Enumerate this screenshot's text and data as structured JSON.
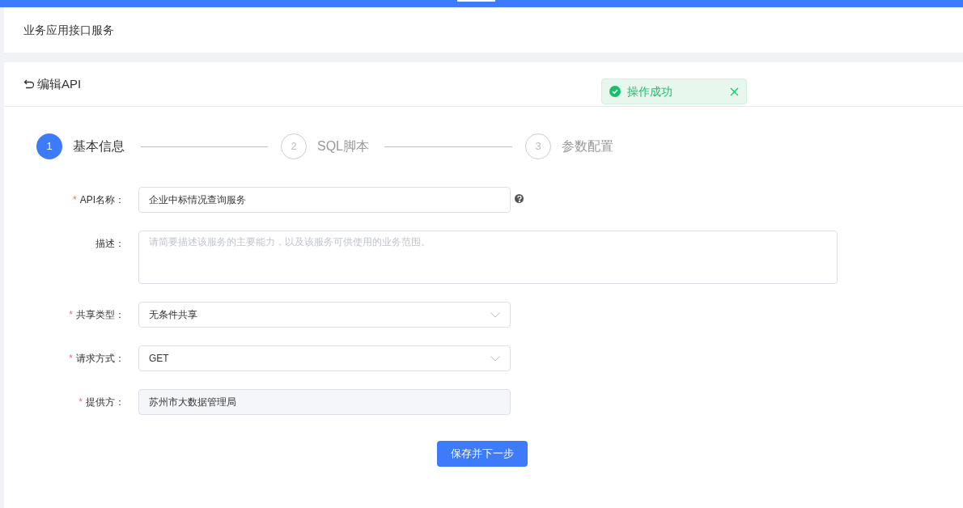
{
  "header": {
    "title": "业务应用接口服务"
  },
  "page": {
    "back_label": "编辑API"
  },
  "toast": {
    "message": "操作成功"
  },
  "steps": [
    {
      "number": "1",
      "label": "基本信息",
      "active": true
    },
    {
      "number": "2",
      "label": "SQL脚本",
      "active": false
    },
    {
      "number": "3",
      "label": "参数配置",
      "active": false
    }
  ],
  "fields": [
    {
      "kind": "input",
      "required_mark": "*",
      "label": "API名称：",
      "value": "企业中标情况查询服务",
      "help": true
    },
    {
      "kind": "textarea",
      "label": "描述：",
      "placeholder": "请简要描述该服务的主要能力，以及该服务可供使用的业务范围。"
    },
    {
      "kind": "select",
      "required_mark": "*",
      "label": "共享类型：",
      "value": "无条件共享"
    },
    {
      "kind": "select",
      "required_mark": "*",
      "label": "请求方式：",
      "value": "GET"
    },
    {
      "kind": "readonly",
      "required_mark": "*",
      "label": "提供方：",
      "value": "苏州市大数据管理局"
    }
  ],
  "submit": {
    "label": "保存并下一步"
  }
}
